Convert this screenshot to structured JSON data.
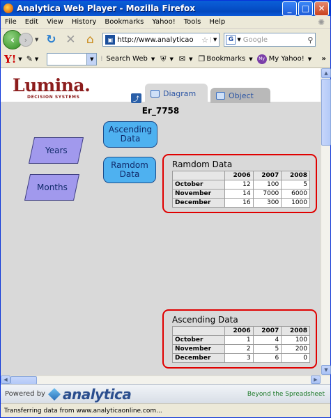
{
  "window": {
    "title": "Analytica Web Player - Mozilla Firefox",
    "minimize": "_",
    "maximize": "□",
    "close": "✕"
  },
  "menu": [
    "File",
    "Edit",
    "View",
    "History",
    "Bookmarks",
    "Yahoo!",
    "Tools",
    "Help"
  ],
  "nav": {
    "url": "http://www.analyticao",
    "search_placeholder": "Google"
  },
  "yahoo_toolbar": {
    "logo": "Y!",
    "search_web": "Search Web",
    "bookmarks": "Bookmarks",
    "my_yahoo": "My Yahoo!",
    "more": "»"
  },
  "app": {
    "logo": "Lumina.",
    "logo_sub": "DECISION SYSTEMS",
    "tabs": [
      "Diagram",
      "Object"
    ],
    "module_title": "Er_7758"
  },
  "nodes": {
    "years": "Years",
    "months": "Months",
    "ascending": "Ascending Data",
    "ramdom": "Ramdom Data"
  },
  "tables": [
    {
      "title": "Ramdom Data",
      "columns": [
        "2006",
        "2007",
        "2008"
      ],
      "rows": [
        {
          "label": "October",
          "values": [
            "12",
            "100",
            "5"
          ]
        },
        {
          "label": "November",
          "values": [
            "14",
            "7000",
            "6000"
          ]
        },
        {
          "label": "December",
          "values": [
            "16",
            "300",
            "1000"
          ]
        }
      ]
    },
    {
      "title": "Ascending Data",
      "columns": [
        "2006",
        "2007",
        "2008"
      ],
      "rows": [
        {
          "label": "October",
          "values": [
            "1",
            "4",
            "100"
          ]
        },
        {
          "label": "November",
          "values": [
            "2",
            "5",
            "200"
          ]
        },
        {
          "label": "December",
          "values": [
            "3",
            "6",
            "0"
          ]
        }
      ]
    }
  ],
  "footer": {
    "powered_by": "Powered by",
    "brand": "analytica",
    "tagline": "Beyond the Spreadsheet"
  },
  "status": "Transferring data from www.analyticaonline.com..."
}
